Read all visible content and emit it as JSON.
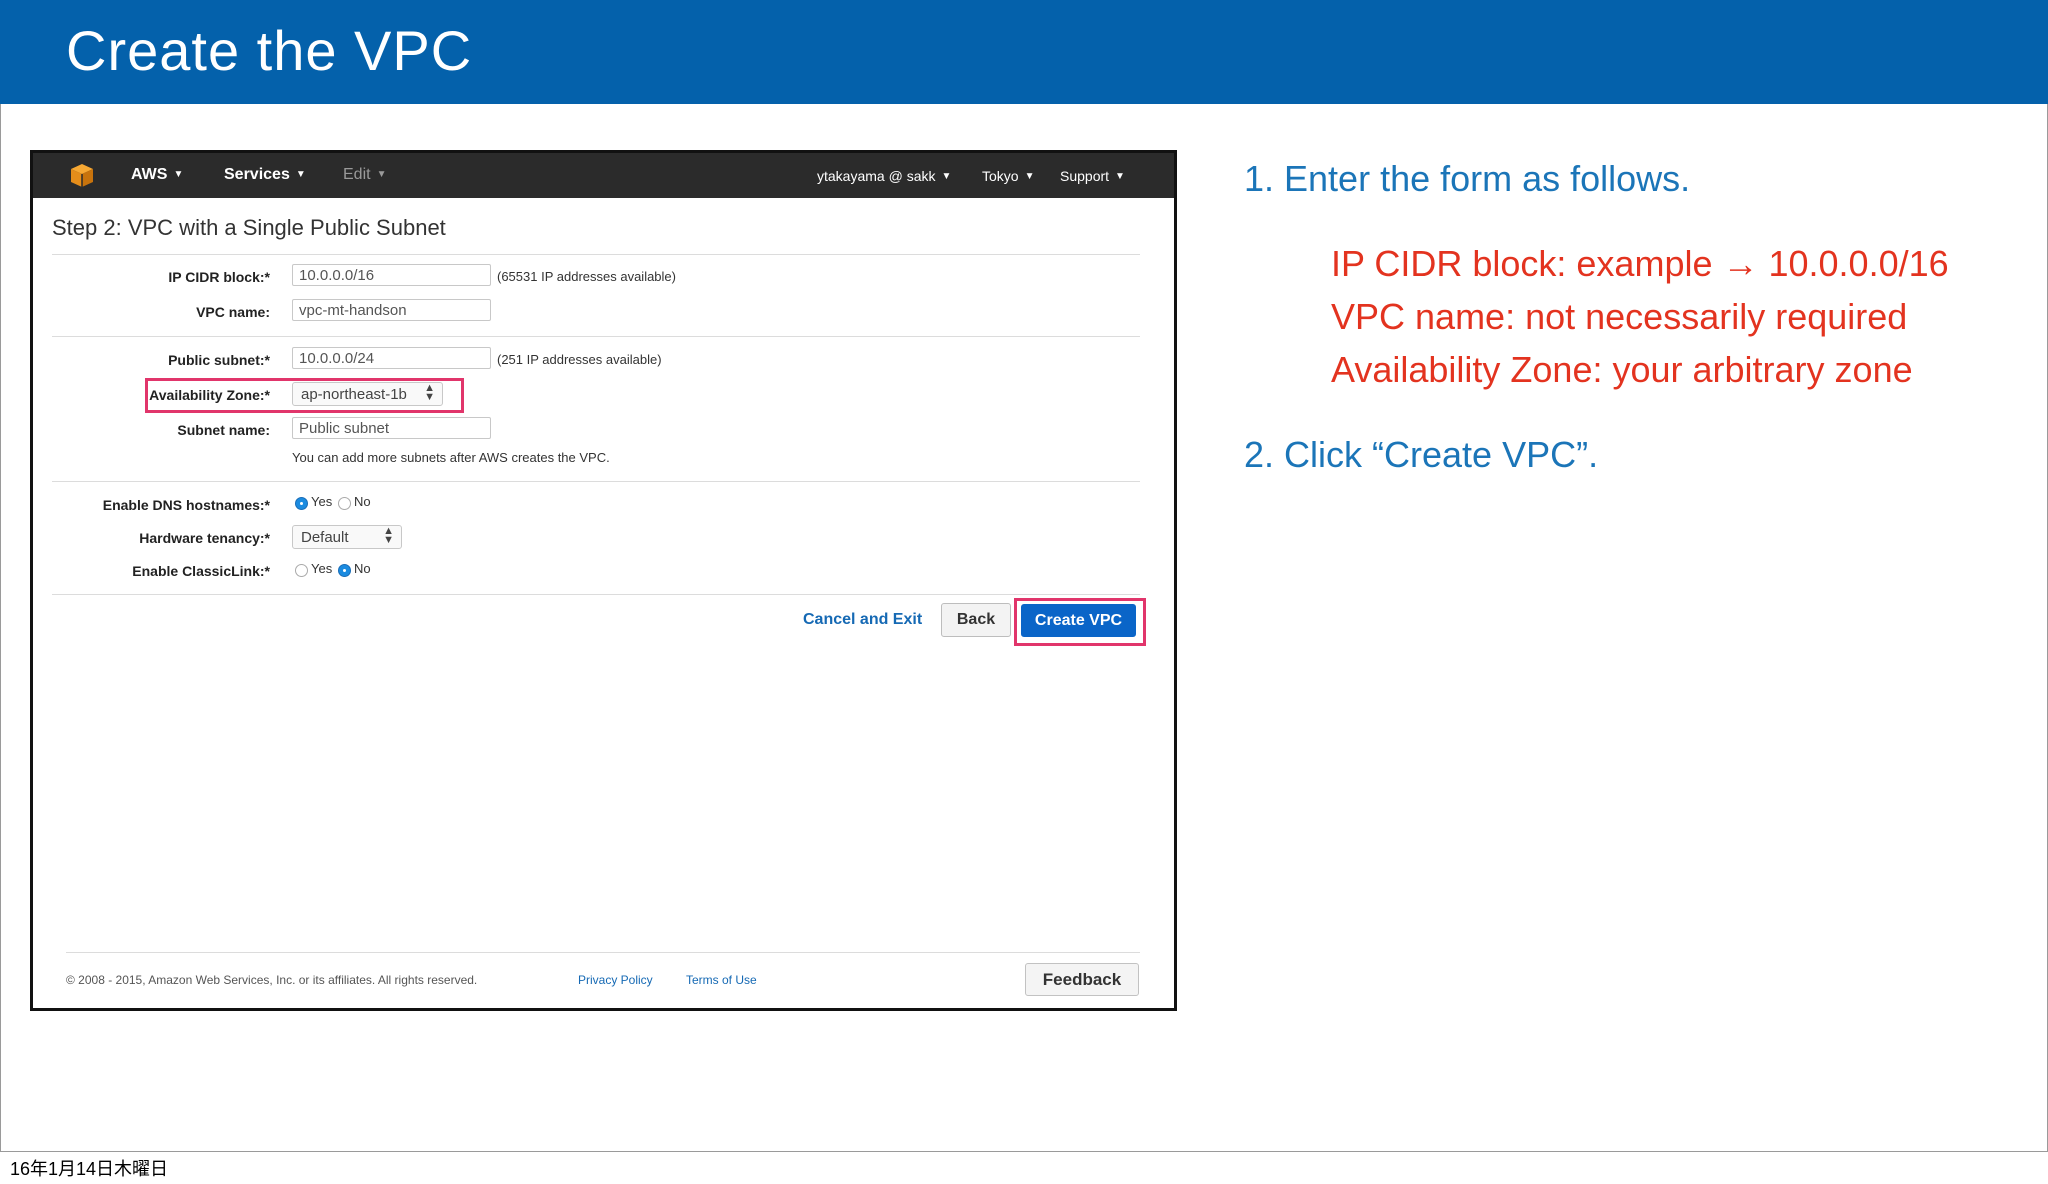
{
  "slide": {
    "title": "Create the VPC",
    "date_label": "16年1月14日木曜日"
  },
  "aws_nav": {
    "logo_icon": "aws-cube-icon",
    "items": [
      {
        "label": "AWS"
      },
      {
        "label": "Services"
      },
      {
        "label": "Edit"
      },
      {
        "label": "ytakayama @ sakk"
      },
      {
        "label": "Tokyo"
      },
      {
        "label": "Support"
      }
    ]
  },
  "form": {
    "title": "Step 2: VPC with a Single Public Subnet",
    "ip_cidr": {
      "label": "IP CIDR block:*",
      "value": "10.0.0.0/16",
      "note": "(65531 IP addresses available)"
    },
    "vpc_name": {
      "label": "VPC name:",
      "value": "vpc-mt-handson"
    },
    "public_subnet": {
      "label": "Public subnet:*",
      "value": "10.0.0.0/24",
      "note": "(251 IP addresses available)"
    },
    "availability_zone": {
      "label": "Availability Zone:*",
      "value": "ap-northeast-1b"
    },
    "subnet_name": {
      "label": "Subnet name:",
      "value": "Public subnet",
      "note": "You can add more subnets after AWS creates the VPC."
    },
    "dns_hostnames": {
      "label": "Enable DNS hostnames:*",
      "yes": "Yes",
      "no": "No",
      "selected": "Yes"
    },
    "hardware_tenancy": {
      "label": "Hardware tenancy:*",
      "value": "Default"
    },
    "classiclink": {
      "label": "Enable ClassicLink:*",
      "yes": "Yes",
      "no": "No",
      "selected": "No"
    },
    "highlight_color": "#e1356b"
  },
  "actions": {
    "cancel_label": "Cancel and Exit",
    "back_label": "Back",
    "create_label": "Create VPC"
  },
  "footer": {
    "copyright": "© 2008 - 2015, Amazon Web Services, Inc. or its affiliates. All rights reserved.",
    "privacy": "Privacy Policy",
    "terms": "Terms of Use",
    "feedback": "Feedback"
  },
  "instructions": {
    "step1": "1.  Enter the form as follows.",
    "details": [
      "IP CIDR block: example → 10.0.0.0/16",
      "VPC name: not necessarily required",
      "Availability Zone: your arbitrary zone"
    ],
    "step2": "2.  Click “Create VPC”.",
    "colors": {
      "step": "#1b75b8",
      "detail": "#e3331f",
      "header": "#0461ab"
    }
  }
}
